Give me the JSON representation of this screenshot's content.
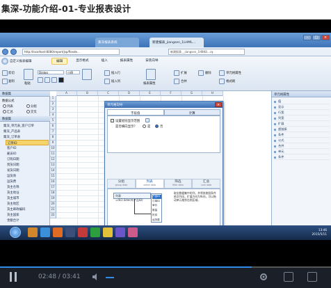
{
  "page_title": "集深-功能介绍-01-专业报表设计",
  "browser": {
    "tabs": [
      "集深报表系统",
      "新建报表_jiangsen_1LHML..."
    ],
    "address": "http://localhost:8080/report/jsp/flexde...",
    "address2": "新建报表 _ jiangsen_1HBK8...cq",
    "win_buttons": [
      "–",
      "□",
      "×"
    ]
  },
  "ribbon": {
    "app_title": "自定义报表编辑",
    "tabs": [
      "编辑",
      "显示格式",
      "插入",
      "报表属性",
      "安装向导"
    ],
    "active_tab": 0,
    "font_name": "Dialog",
    "font_size": "小四",
    "items": [
      "剪切",
      "复制",
      "粘贴",
      "插入行",
      "插入列",
      "报表属性",
      "扩展",
      "合并",
      "删除",
      "报表属性",
      "单元格属性",
      "格式刷"
    ],
    "paste_label": "粘贴"
  },
  "left_panel": {
    "title": "数据集",
    "section": "数据公式",
    "opt_left": "列表",
    "opt_right": "分组",
    "opt_left2": "汇总",
    "opt_right2": "交叉",
    "dataset_header": "数据集",
    "tree": [
      "集深_单元表_客户订单",
      "集深_产品表",
      "集深_订单表",
      "订单ID",
      "客户ID",
      "雇员ID",
      "订购日期",
      "到货日期",
      "发货日期",
      "运货商",
      "运货费",
      "货主名称",
      "货主地址",
      "货主城市",
      "货主地区",
      "货主邮政编码",
      "货主国家",
      "金额合计"
    ],
    "selected": 3
  },
  "sheet": {
    "name_box": "选中单元格",
    "cols": [
      "A",
      "B",
      "C",
      "D",
      "E",
      "F",
      "G",
      "H"
    ],
    "rows": [
      "1",
      "2",
      "3",
      "4",
      "5",
      "6",
      "7",
      "8",
      "9",
      "10",
      "11",
      "12",
      "13",
      "14",
      "15",
      "16",
      "17",
      "18",
      "19",
      "20",
      "21",
      "22"
    ]
  },
  "right_panel": {
    "title": "单元格属性",
    "props": [
      "值",
      "显示",
      "行宽",
      "列宽",
      "扩展",
      "超链接",
      "条件",
      "公式",
      "合并",
      "单元",
      "条件"
    ]
  },
  "dialog": {
    "title": "单元格向导",
    "tabs": [
      "字段值",
      "计算"
    ],
    "active_tab": 0,
    "check_label": "设置组别显示范围",
    "question": "是否横向显示？",
    "radio_yes": "是",
    "radio_no": "否",
    "check_mark": "✓",
    "ptabs": [
      {
        "label": "分组",
        "sub": "group data"
      },
      {
        "label": "列表",
        "sub": "select data"
      },
      {
        "label": "筛选",
        "sub": "filter data"
      },
      {
        "label": "汇总",
        "sub": "sum data"
      }
    ],
    "active_ptab": 1,
    "field_label": "列表",
    "field_value": "=ds1.Select(产品ID)",
    "dd_items": [
      "产品ID",
      "订单ID",
      "单价",
      "数量",
      "折扣",
      "运货费"
    ],
    "dd_selected": 0,
    "help": "取出数据集中的列，并将其按照条件依次列出，扩展方向为纵向，可以拖动单元格到右侧区域。",
    "ok": "确定",
    "cancel": "取消"
  },
  "taskbar": {
    "time": "13:46",
    "date": "2015/5/11"
  },
  "player": {
    "time": "02:48 / 03:41",
    "progress": 0.76,
    "accent": "#2f8ce8"
  }
}
